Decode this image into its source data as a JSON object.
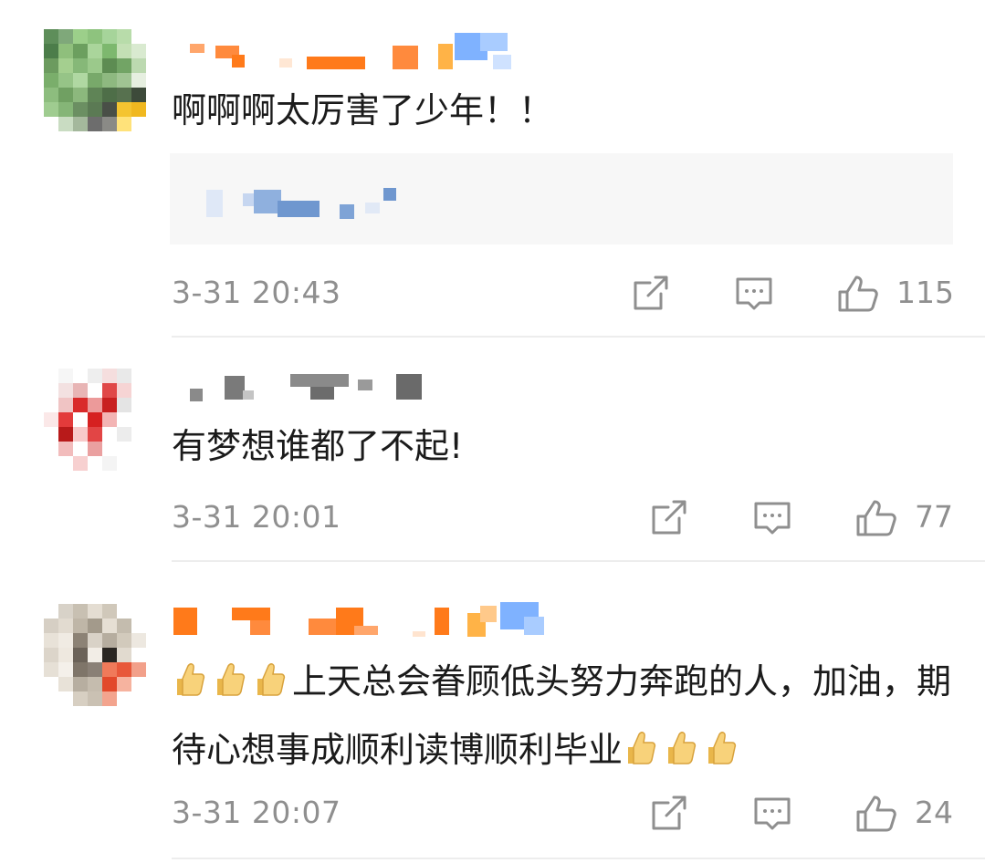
{
  "comments": [
    {
      "text": "啊啊啊太厉害了少年！！",
      "time": "3-31 20:43",
      "likes": "115"
    },
    {
      "text": "有梦想谁都了不起!",
      "time": "3-31 20:01",
      "likes": "77"
    },
    {
      "text_prefix": "👍👍👍",
      "text": "上天总会眷顾低头努力奔跑的人，加油，期待心想事成顺利读博顺利毕业",
      "text_suffix": "👍👍👍",
      "time": "3-31 20:07",
      "likes": "24"
    }
  ],
  "colors": {
    "text": "#1b1b1b",
    "meta": "#8f8f8f",
    "divider": "#ededed",
    "quote_bg": "#f7f7f7",
    "nick_orange": "#ff7a1a",
    "nick_blue": "#6aa8ff"
  },
  "icons": {
    "share": "share-square-icon",
    "comment": "comment-bubble-icon",
    "like": "thumbs-up-icon"
  }
}
